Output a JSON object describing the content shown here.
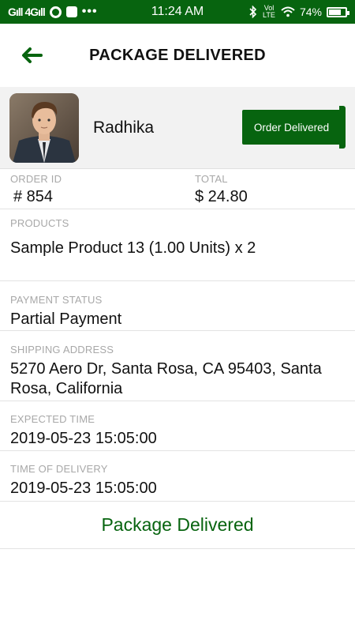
{
  "status_bar": {
    "network": "Gıll 4Gıll",
    "time": "11:24 AM",
    "volte": "Vol LTE",
    "battery": "74%",
    "battery_level": 0.74
  },
  "header": {
    "title": "PACKAGE DELIVERED"
  },
  "customer": {
    "name": "Radhika",
    "status_button": "Order Delivered"
  },
  "order": {
    "id_label": "ORDER ID",
    "id_value": "# 854",
    "total_label": "TOTAL",
    "total_value": "$ 24.80"
  },
  "products": {
    "label": "PRODUCTS",
    "value": "Sample Product 13 (1.00 Units) x 2"
  },
  "payment": {
    "label": "PAYMENT STATUS",
    "value": "Partial Payment"
  },
  "shipping": {
    "label": "SHIPPING ADDRESS",
    "value": "5270 Aero Dr, Santa Rosa, CA 95403, Santa Rosa, California"
  },
  "expected": {
    "label": "EXPECTED TIME",
    "value": "2019-05-23 15:05:00"
  },
  "delivery": {
    "label": "TIME OF DELIVERY",
    "value": "2019-05-23 15:05:00"
  },
  "footer": {
    "button_label": "Package Delivered"
  },
  "colors": {
    "brand": "#07640f",
    "label_gray": "#a8a8a8",
    "row_bg": "#f2f2f2"
  }
}
